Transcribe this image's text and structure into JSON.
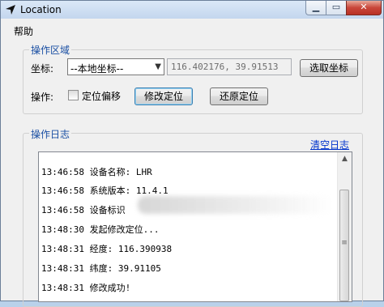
{
  "window": {
    "title": "Location"
  },
  "menubar": {
    "help": "帮助"
  },
  "operation_area": {
    "title": "操作区域",
    "coordinate_label": "坐标:",
    "coordinate_select": "--本地坐标--",
    "coordinate_value": "116.402176, 39.91513",
    "pick_button": "选取坐标",
    "operation_label": "操作:",
    "offset_checkbox": "定位偏移",
    "offset_checked": false,
    "modify_button": "修改定位",
    "restore_button": "还原定位"
  },
  "log_area": {
    "title": "操作日志",
    "clear_link": "清空日志",
    "lines": [
      "13:46:58 设备名称: LHR",
      "13:46:58 系统版本: 11.4.1",
      "13:46:58 设备标识",
      "13:48:30 发起修改定位...",
      "13:48:31 经度: 116.390938",
      "13:48:31 纬度: 39.91105",
      "13:48:31 修改成功!"
    ]
  },
  "icons": {
    "app": "location-arrow-icon"
  }
}
